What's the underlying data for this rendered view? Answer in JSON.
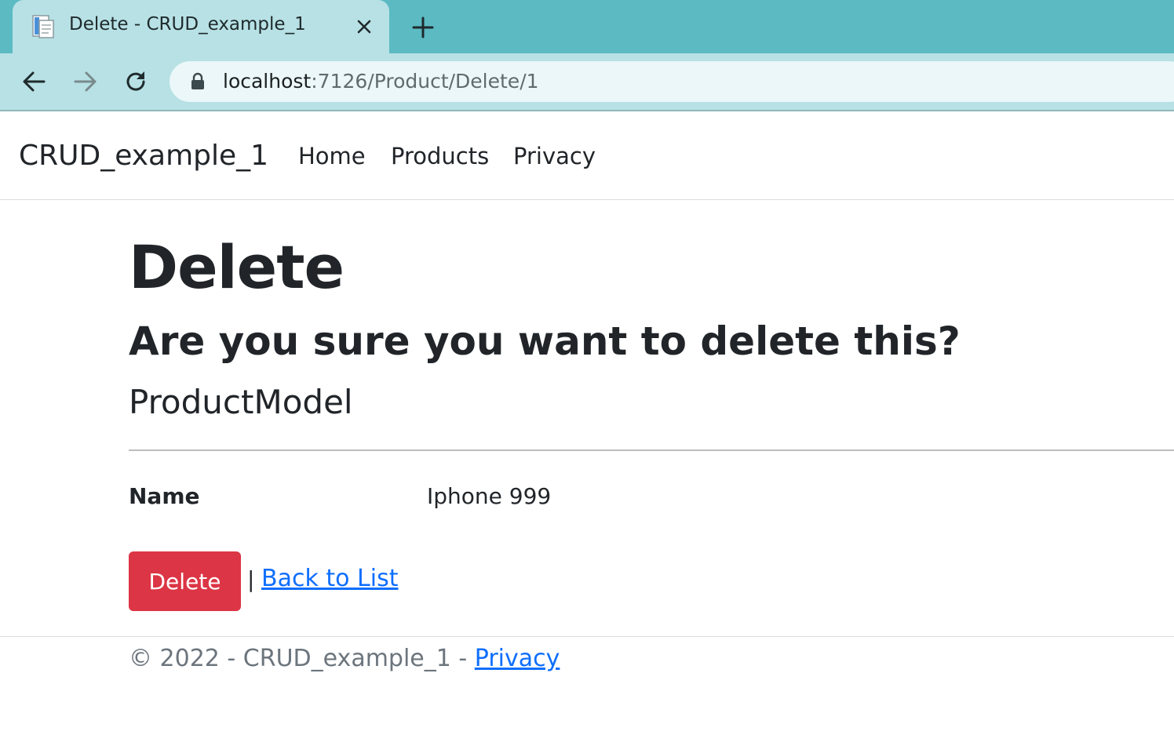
{
  "browser": {
    "tab_title": "Delete - CRUD_example_1",
    "url_host": "localhost",
    "url_rest": ":7126/Product/Delete/1",
    "icons": {
      "favicon": "page-icon",
      "close": "close-icon",
      "new_tab": "plus-icon",
      "back": "arrow-left-icon",
      "forward": "arrow-right-icon",
      "reload": "reload-icon",
      "lock": "lock-icon"
    },
    "colors": {
      "tabstrip": "#5cbac3",
      "toolbar": "#b7e1e5",
      "omnibox": "#ebf7f8"
    }
  },
  "navbar": {
    "brand": "CRUD_example_1",
    "links": [
      "Home",
      "Products",
      "Privacy"
    ]
  },
  "main": {
    "heading": "Delete",
    "question": "Are you sure you want to delete this?",
    "model_title": "ProductModel",
    "fields": [
      {
        "label": "Name",
        "value": "Iphone 999"
      }
    ],
    "delete_button": "Delete",
    "separator": "|",
    "back_link": "Back to List"
  },
  "footer": {
    "text": "© 2022 - CRUD_example_1 - ",
    "privacy_link": "Privacy"
  },
  "colors": {
    "danger": "#dc3545",
    "link": "#0d6efd",
    "muted": "#6c757d"
  }
}
